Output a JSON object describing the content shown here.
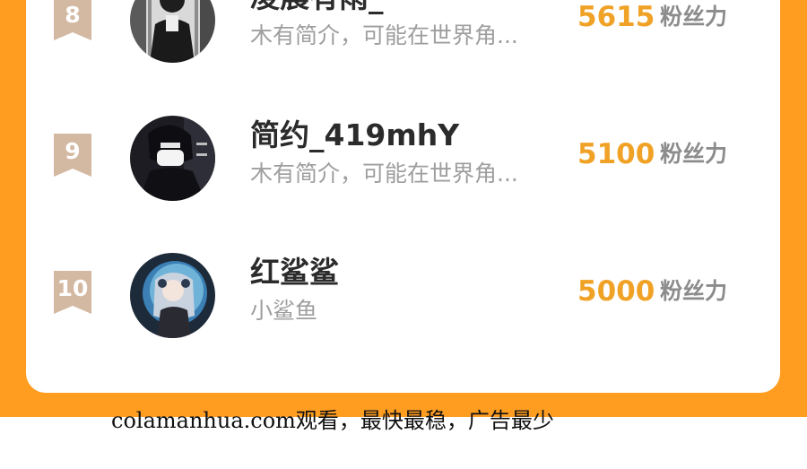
{
  "rows": [
    {
      "rank": "8",
      "name": "凌晨有雨_",
      "bio": "木有简介，可能在世界角...",
      "score": "5615",
      "score_label": "粉丝力"
    },
    {
      "rank": "9",
      "name": "简约_419mhY",
      "bio": "木有简介，可能在世界角...",
      "score": "5100",
      "score_label": "粉丝力"
    },
    {
      "rank": "10",
      "name": "红鲨鲨",
      "bio": "小鲨鱼",
      "score": "5000",
      "score_label": "粉丝力"
    }
  ],
  "footer": {
    "text": "colamanhua.com观看，最快最稳，广告最少"
  },
  "colors": {
    "accent_orange": "#ff9d21",
    "score": "#f0a226",
    "rank_badge": "#d3b8a2"
  }
}
